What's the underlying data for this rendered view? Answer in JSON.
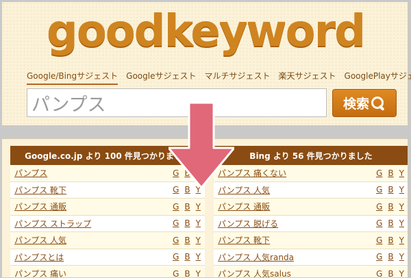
{
  "logo": "goodkeyword",
  "tabs": [
    {
      "label": "Google/Bingサジェスト",
      "active": true
    },
    {
      "label": "Googleサジェスト"
    },
    {
      "label": "マルチサジェスト"
    },
    {
      "label": "楽天サジェスト"
    },
    {
      "label": "GooglePlayサジェスト"
    }
  ],
  "search": {
    "value": "パンプス",
    "button_label": "検索"
  },
  "google": {
    "header": "Google.co.jp より 100 件見つかりました",
    "rows": [
      "パンプス",
      "パンプス 靴下",
      "パンプス 通販",
      "パンプス ストラップ",
      "パンプス 人気",
      "パンプスとは",
      "パンプス 痛い"
    ]
  },
  "bing": {
    "header": "Bing より 56 件見つかりました",
    "rows": [
      "パンプス 痛くない",
      "パンプス 人気",
      "パンプス 通販",
      "パンプス 脱げる",
      "パンプス 靴下",
      "パンプス 人気randa",
      "パンプス 人気salus"
    ]
  },
  "link_labels": {
    "g": "G",
    "b": "B",
    "y": "Y"
  },
  "colors": {
    "brand": "#cf8420",
    "header_bg": "#8a4c12",
    "arrow": "#e06878"
  }
}
